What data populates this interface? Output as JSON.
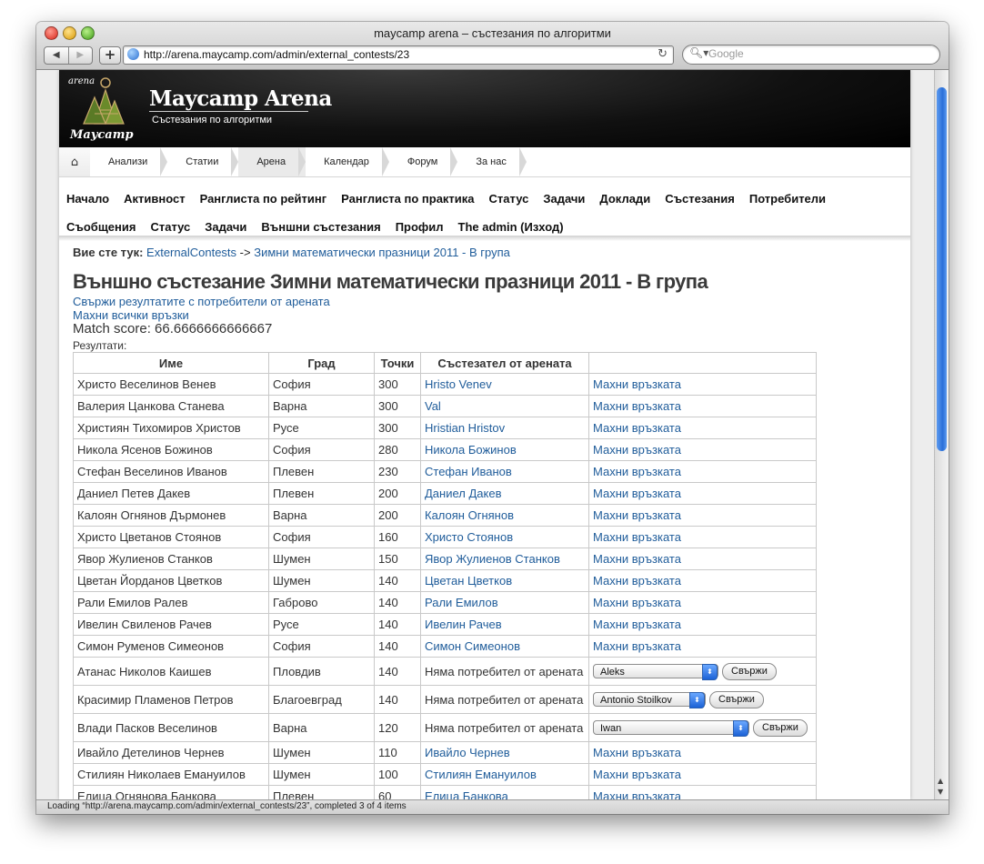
{
  "window": {
    "title": "maycamp arena – състезания по алгоритми",
    "url": "http://arena.maycamp.com/admin/external_contests/23",
    "search_placeholder": "Google",
    "status": "Loading “http://arena.maycamp.com/admin/external_contests/23”, completed 3 of 4 items"
  },
  "site": {
    "logo_small": "arena",
    "logo_name": "Maycamp",
    "title": "Maycamp Arena",
    "subtitle": "Състезания по алгоритми"
  },
  "tabs": [
    "Анализи",
    "Статии",
    "Арена",
    "Календар",
    "Форум",
    "За нас"
  ],
  "menu": {
    "row1": [
      "Начало",
      "Активност",
      "Ранглиста по рейтинг",
      "Ранглиста по практика",
      "Статус",
      "Задачи",
      "Доклади",
      "Състезания",
      "Потребители"
    ],
    "row2": [
      "Съобщения",
      "Статус",
      "Задачи",
      "Външни състезания",
      "Профил",
      "The admin (Изход)"
    ]
  },
  "breadcrumb": {
    "label": "Вие сте тук:",
    "link1": "ExternalContests",
    "sep": "->",
    "link2": "Зимни математически празници 2011 - В група"
  },
  "page": {
    "title": "Външно състезание Зимни математически празници 2011 - В група",
    "link_connect": "Свържи резултатите с потребители от арената",
    "link_remove": "Махни всички връзки",
    "score": "Match score: 66.6666666666667",
    "results_label": "Резултати:"
  },
  "table": {
    "headers": [
      "Име",
      "Град",
      "Точки",
      "Състезател от арената",
      ""
    ],
    "unlink_label": "Махни връзката",
    "no_user_label": "Няма потребител от арената",
    "connect_label": "Свържи",
    "rows": [
      {
        "name": "Христо Веселинов Венев",
        "city": "София",
        "points": "300",
        "arena": "Hristo Venev"
      },
      {
        "name": "Валерия Цанкова Станева",
        "city": "Варна",
        "points": "300",
        "arena": "Val"
      },
      {
        "name": "Християн Тихомиров Христов",
        "city": "Русе",
        "points": "300",
        "arena": "Hristian Hristov"
      },
      {
        "name": "Никола Ясенов Божинов",
        "city": "София",
        "points": "280",
        "arena": "Никола Божинов"
      },
      {
        "name": "Стефан Веселинов Иванов",
        "city": "Плевен",
        "points": "230",
        "arena": "Стефан Иванов"
      },
      {
        "name": "Даниел Петев Дакев",
        "city": "Плевен",
        "points": "200",
        "arena": "Даниел Дакев"
      },
      {
        "name": "Калоян Огнянов Дърмонев",
        "city": "Варна",
        "points": "200",
        "arena": "Калоян Огнянов"
      },
      {
        "name": "Христо Цветанов Стоянов",
        "city": "София",
        "points": "160",
        "arena": "Христо Стоянов"
      },
      {
        "name": "Явор Жулиенов Станков",
        "city": "Шумен",
        "points": "150",
        "arena": "Явор Жулиенов Станков"
      },
      {
        "name": "Цветан Йорданов Цветков",
        "city": "Шумен",
        "points": "140",
        "arena": "Цветан Цветков"
      },
      {
        "name": "Рали Емилов Ралев",
        "city": "Габрово",
        "points": "140",
        "arena": "Рали Емилов"
      },
      {
        "name": "Ивелин Свиленов Рачев",
        "city": "Русе",
        "points": "140",
        "arena": "Ивелин Рачев"
      },
      {
        "name": "Симон Руменов Симеонов",
        "city": "София",
        "points": "140",
        "arena": "Симон Симеонов"
      },
      {
        "name": "Атанас Николов Каишев",
        "city": "Пловдив",
        "points": "140",
        "select": "Aleks"
      },
      {
        "name": "Красимир Пламенов Петров",
        "city": "Благоевград",
        "points": "140",
        "select": "Antonio Stoilkov"
      },
      {
        "name": "Влади Пасков Веселинов",
        "city": "Варна",
        "points": "120",
        "select": "Iwan"
      },
      {
        "name": "Ивайло Детелинов Чернев",
        "city": "Шумен",
        "points": "110",
        "arena": "Ивайло Чернев"
      },
      {
        "name": "Стилиян Николаев Емануилов",
        "city": "Шумен",
        "points": "100",
        "arena": "Стилиян Емануилов"
      },
      {
        "name": "Елица Огнянова Банкова",
        "city": "Плевен",
        "points": "60",
        "arena": "Елица Банкова"
      }
    ]
  }
}
